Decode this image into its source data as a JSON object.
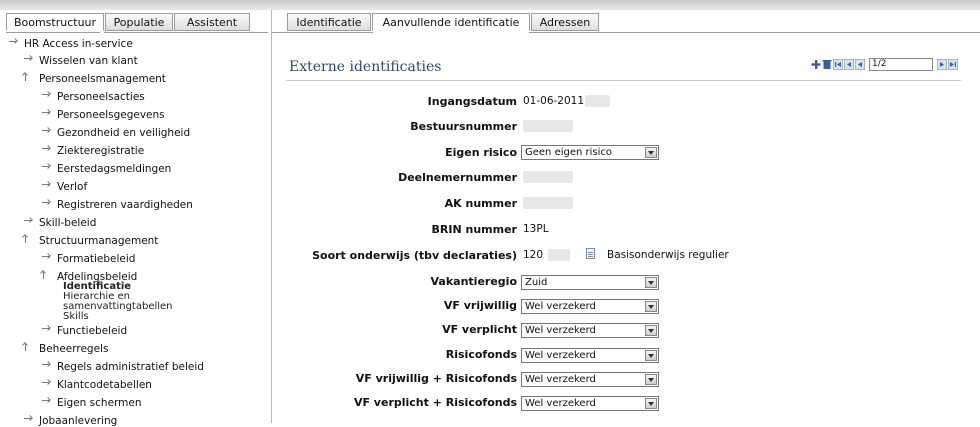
{
  "left_tabs": [
    "Boomstructuur",
    "Populatie",
    "Assistent"
  ],
  "right_tabs": [
    "Identificatie",
    "Aanvullende identificatie",
    "Adressen"
  ],
  "tree": {
    "root": "HR Access in-service",
    "wisselen": "Wisselen van klant",
    "personeelsmanagement": "Personeelsmanagement",
    "personeelsacties": "Personeelsacties",
    "personeelsgegevens": "Personeelsgegevens",
    "gezondheid": "Gezondheid en veiligheid",
    "ziekteregistratie": "Ziekteregistratie",
    "eerstedag": "Eerstedagsmeldingen",
    "verlof": "Verlof",
    "registreren": "Registreren vaardigheden",
    "skill": "Skill-beleid",
    "structuur": "Structuurmanagement",
    "formatie": "Formatiebeleid",
    "afdeling": "Afdelingsbeleid",
    "afdeling_sub": [
      "Identificatie",
      "Hierarchie en samenvattingtabellen",
      "Skills"
    ],
    "functie": "Functiebeleid",
    "beheer": "Beheerregels",
    "regels": "Regels administratief beleid",
    "klantcode": "Klantcodetabellen",
    "eigen": "Eigen schermen",
    "jobaanlevering": "Jobaanlevering"
  },
  "section_title": "Externe identificaties",
  "pager_value": "1/2",
  "fields": {
    "ingangsdatum": {
      "label": "Ingangsdatum",
      "value": "01-06-2011"
    },
    "bestuursnummer": {
      "label": "Bestuursnummer"
    },
    "eigen_risico": {
      "label": "Eigen risico",
      "value": "Geen eigen risico"
    },
    "deelnemernummer": {
      "label": "Deelnemernummer"
    },
    "ak_nummer": {
      "label": "AK nummer"
    },
    "brin": {
      "label": "BRIN nummer",
      "value": "13PL"
    },
    "soort_onderwijs": {
      "label": "Soort onderwijs (tbv declaraties)",
      "value": "120",
      "desc": "Basisonderwijs regulier"
    },
    "vakantieregio": {
      "label": "Vakantieregio",
      "value": "Zuid"
    },
    "vf_vrijwillig": {
      "label": "VF vrijwillig",
      "value": "Wel verzekerd"
    },
    "vf_verplicht": {
      "label": "VF verplicht",
      "value": "Wel verzekerd"
    },
    "risicofonds": {
      "label": "Risicofonds",
      "value": "Wel verzekerd"
    },
    "vf_vrijwillig_risico": {
      "label": "VF vrijwillig + Risicofonds",
      "value": "Wel verzekerd"
    },
    "vf_verplicht_risico": {
      "label": "VF verplicht + Risicofonds",
      "value": "Wel verzekerd"
    }
  },
  "colors": {
    "section_title": "#2e4b6e",
    "pager_icon": "#3a5f9a"
  }
}
